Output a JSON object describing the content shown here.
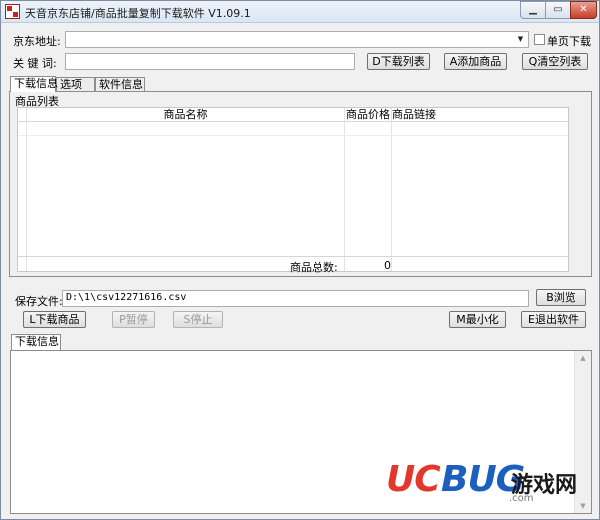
{
  "window": {
    "title": "天音京东店铺/商品批量复制下载软件 V1.09.1"
  },
  "form": {
    "url_label": "京东地址:",
    "url_value": "",
    "single_page_label": "单页下载",
    "keyword_label": "关 键 词:",
    "keyword_value": "",
    "download_list_btn": "D下载列表",
    "add_product_btn": "A添加商品",
    "clear_list_btn": "Q清空列表"
  },
  "tabs": [
    "下载信息",
    "选项",
    "软件信息"
  ],
  "product_list": {
    "section_title": "商品列表",
    "columns": [
      "商品名称",
      "商品价格",
      "商品链接"
    ],
    "rows": [],
    "total_label": "商品总数:",
    "total_value": "0"
  },
  "save": {
    "label": "保存文件:",
    "path": "D:\\1\\csv12271616.csv",
    "browse_btn": "B浏览"
  },
  "actions": {
    "download_btn": "L下载商品",
    "pause_btn": "P暂停",
    "stop_btn": "S停止",
    "minimize_btn": "M最小化",
    "exit_btn": "E退出软件"
  },
  "log": {
    "tab_label": "下载信息",
    "content": ""
  },
  "watermark": {
    "uc": "UC",
    "bug": "BUG",
    "cn": "游戏网",
    "domain": ".com"
  },
  "colors": {
    "accent_red": "#e2372a",
    "accent_blue": "#1d5fbf",
    "window_bg": "#f0f0f0"
  }
}
